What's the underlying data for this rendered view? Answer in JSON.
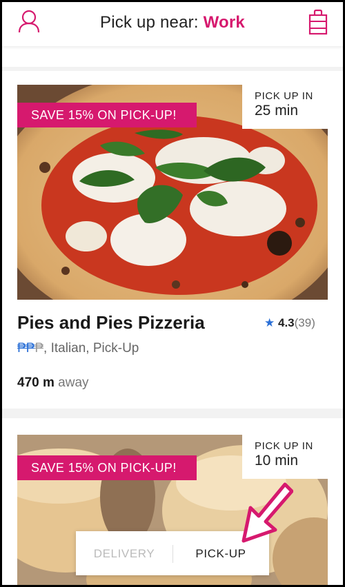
{
  "header": {
    "title_prefix": "Pick up near:",
    "location": "Work"
  },
  "restaurants": [
    {
      "promo": "SAVE 15% ON PICK-UP!",
      "pickup_label": "PICK UP IN",
      "pickup_time": "25 min",
      "name": "Pies and Pies Pizzeria",
      "rating": "4.3",
      "rating_count": "(39)",
      "price_active": "₱₱",
      "price_inactive": "₱",
      "cuisine": ", Italian, Pick-Up",
      "distance_value": "470 m",
      "distance_suffix": " away"
    },
    {
      "promo": "SAVE 15% ON PICK-UP!",
      "pickup_label": "PICK UP IN",
      "pickup_time": "10 min"
    }
  ],
  "mode_toggle": {
    "delivery_label": "DELIVERY",
    "pickup_label": "PICK-UP",
    "selected": "PICK-UP"
  },
  "icons": {
    "user": "user-icon",
    "bag": "shopping-bag-icon",
    "star": "star-icon",
    "arrow": "pointer-arrow-icon"
  },
  "colors": {
    "brand": "#d6196e",
    "star": "#2a6fd6"
  }
}
